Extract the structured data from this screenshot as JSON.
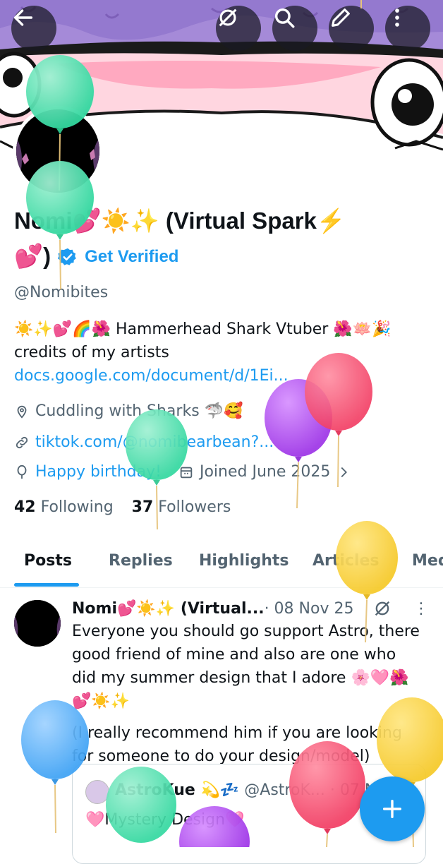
{
  "header": {
    "back_icon": "arrow-left-icon",
    "grok_icon": "grok-icon",
    "search_icon": "search-icon",
    "edit_icon": "pencil-icon",
    "more_icon": "more-vertical-icon"
  },
  "profile": {
    "name_line1": "Nomi💕☀️✨ (Virtual Spark⚡",
    "name_line2": "💕)",
    "get_verified": "Get Verified",
    "handle": "@Nomibites",
    "bio_line1": "☀️✨💕🌈🌺 Hammerhead Shark Vtuber 🌺🪷🎉",
    "bio_line2_text": "credits of my artists ",
    "bio_link": "docs.google.com/document/d/1Ei...",
    "location": "Cuddling with Sharks 🦈🥰",
    "website": "tiktok.com/@nomibearbean?...",
    "birthday": "Happy birthday!",
    "joined": "Joined June 2025",
    "following_count": "42",
    "following_label": "Following",
    "followers_count": "37",
    "followers_label": "Followers"
  },
  "tabs": [
    "Posts",
    "Replies",
    "Highlights",
    "Articles",
    "Media"
  ],
  "post": {
    "author": "Nomi💕☀️✨ (Virtual...",
    "date": " · 08 Nov 25",
    "text1": "Everyone you should go support Astro, there good friend of mine and also are one who did my summer design that I adore 🌸🩷🌺💕☀️✨",
    "text2": "(I really recommend him if you are looking for someone to do your design/model)",
    "quote": {
      "name": "AstroKue 💫💤",
      "handle": " @AstroK... · 07 N",
      "text": "🩷Mystery Design🩷"
    }
  },
  "colors": {
    "accent": "#1d9bf0",
    "banner_purple": "#a58ad8",
    "banner_pink": "#ffb6c8"
  }
}
